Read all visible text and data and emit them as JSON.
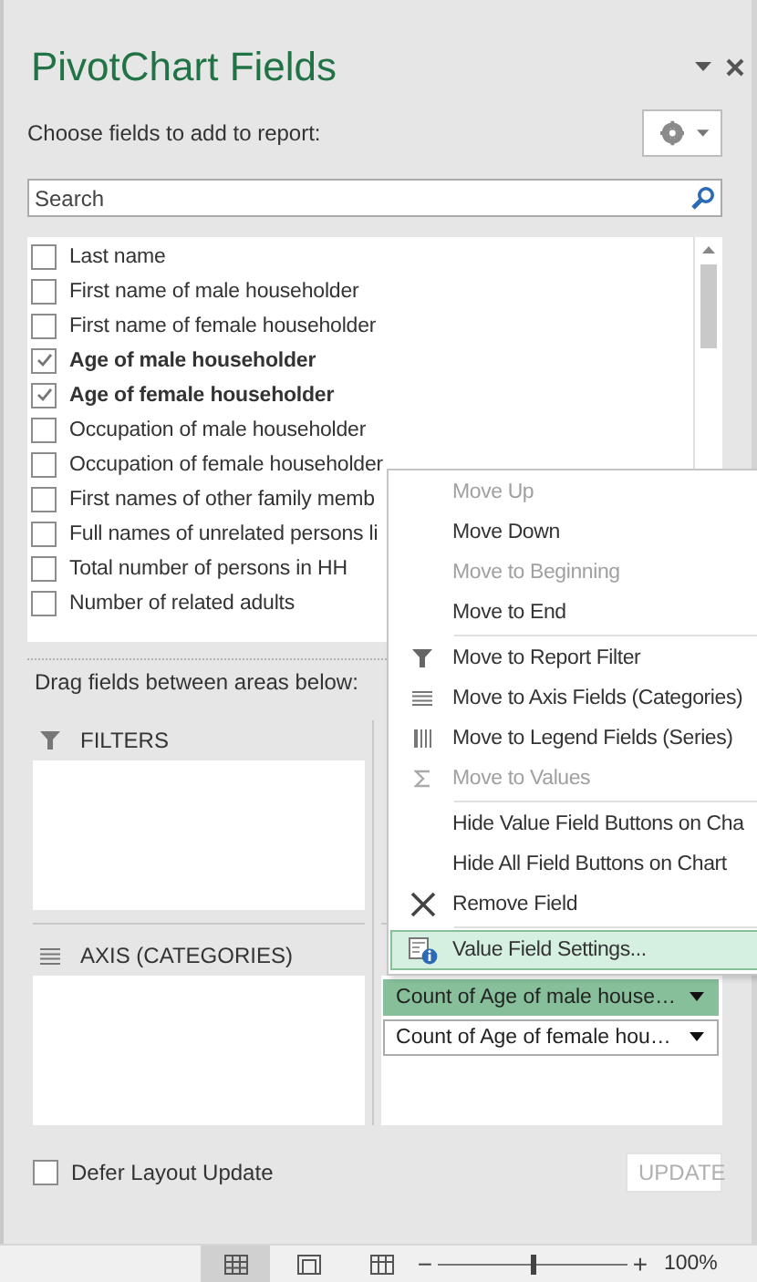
{
  "pane": {
    "title": "PivotChart Fields",
    "instruction": "Choose fields to add to report:"
  },
  "search": {
    "placeholder": "Search"
  },
  "fields": [
    {
      "label": "Last name",
      "checked": false
    },
    {
      "label": "First name of male householder",
      "checked": false
    },
    {
      "label": "First name of female householder",
      "checked": false
    },
    {
      "label": "Age of male householder",
      "checked": true
    },
    {
      "label": "Age of female householder",
      "checked": true
    },
    {
      "label": "Occupation of male householder",
      "checked": false
    },
    {
      "label": "Occupation of female householder",
      "checked": false
    },
    {
      "label": "First names of other family memb",
      "checked": false
    },
    {
      "label": "Full names of unrelated persons li",
      "checked": false
    },
    {
      "label": "Total number of persons in HH",
      "checked": false
    },
    {
      "label": "Number of related adults",
      "checked": false
    }
  ],
  "areas_instruction": "Drag fields between areas below:",
  "filters": {
    "title": "FILTERS"
  },
  "axis": {
    "title": "AXIS (CATEGORIES)"
  },
  "values": {
    "items": [
      {
        "label": "Count of Age of male house…",
        "selected": true
      },
      {
        "label": "Count of Age of female hou…",
        "selected": false
      }
    ]
  },
  "context_menu": {
    "items": [
      {
        "label": "Move Up",
        "disabled": true,
        "selected": false,
        "divider_after": false
      },
      {
        "label": "Move Down",
        "disabled": false,
        "selected": false,
        "divider_after": false
      },
      {
        "label": "Move to Beginning",
        "disabled": true,
        "selected": false,
        "divider_after": false
      },
      {
        "label": "Move to End",
        "disabled": false,
        "selected": false,
        "divider_after": true
      },
      {
        "label": "Move to Report Filter",
        "kind": "filter",
        "disabled": false,
        "selected": false,
        "divider_after": false
      },
      {
        "label": "Move to Axis Fields (Categories)",
        "kind": "rows",
        "disabled": false,
        "selected": false,
        "divider_after": false
      },
      {
        "label": "Move to Legend Fields (Series)",
        "kind": "columns",
        "disabled": false,
        "selected": false,
        "divider_after": false
      },
      {
        "label": "Move to Values",
        "kind": "sigma",
        "disabled": true,
        "selected": false,
        "divider_after": true
      },
      {
        "label": "Hide Value Field Buttons on Cha",
        "disabled": false,
        "selected": false,
        "divider_after": false
      },
      {
        "label": "Hide All Field Buttons on Chart",
        "disabled": false,
        "selected": false,
        "divider_after": false
      },
      {
        "label": "Remove Field",
        "kind": "remove",
        "disabled": false,
        "selected": false,
        "divider_after": true
      },
      {
        "label": "Value Field Settings...",
        "kind": "settings",
        "disabled": false,
        "selected": true,
        "divider_after": false
      }
    ]
  },
  "defer_layout": {
    "label": "Defer Layout Update",
    "checked": false
  },
  "update_button": {
    "label": "UPDATE",
    "disabled": true
  },
  "status_bar": {
    "views": [
      {
        "kind": "normal",
        "selected": true
      },
      {
        "kind": "page_layout",
        "selected": false
      },
      {
        "kind": "page_break",
        "selected": false
      }
    ],
    "zoom": {
      "minus": "−",
      "plus": "+",
      "level": 0.5,
      "reading": "100%"
    }
  }
}
